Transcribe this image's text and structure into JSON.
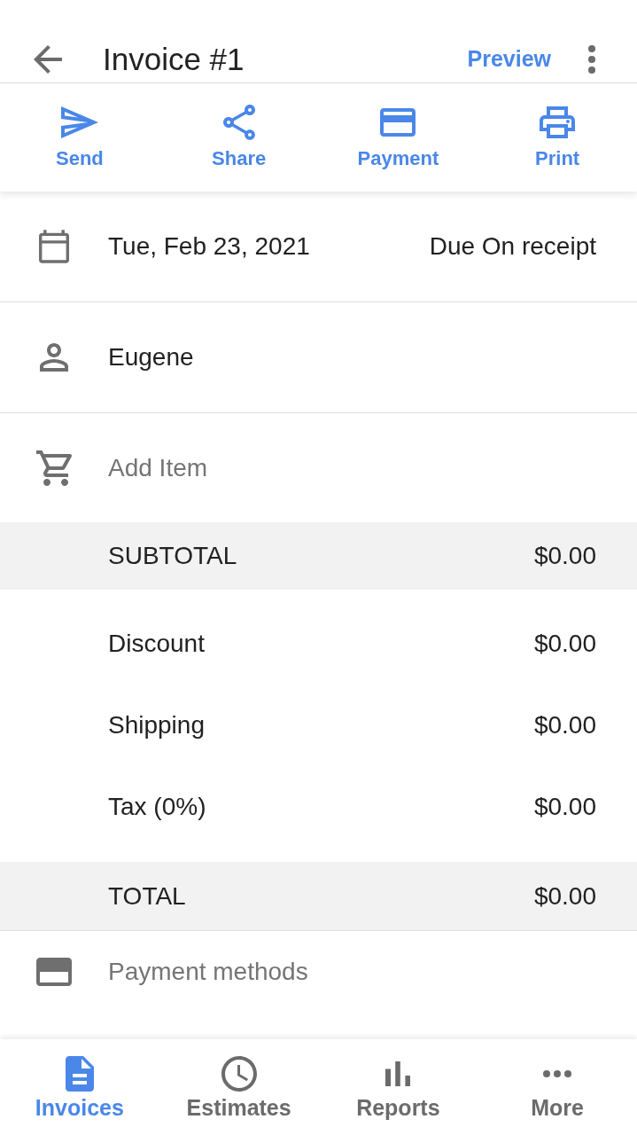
{
  "app_bar": {
    "title": "Invoice #1",
    "action": "Preview"
  },
  "actions": [
    {
      "kind": "send",
      "label": "Send"
    },
    {
      "kind": "share",
      "label": "Share"
    },
    {
      "kind": "payment",
      "label": "Payment"
    },
    {
      "kind": "print",
      "label": "Print"
    }
  ],
  "invoice": {
    "date": "Tue, Feb 23, 2021",
    "terms": "Due On receipt",
    "customer": "Eugene",
    "add_item": "Add Item"
  },
  "summary": [
    {
      "kind": "total",
      "label": "SUBTOTAL",
      "amount": "$0.00"
    },
    {
      "kind": "line",
      "label": "Discount",
      "amount": "$0.00"
    },
    {
      "kind": "line",
      "label": "Shipping",
      "amount": "$0.00"
    },
    {
      "kind": "line",
      "label": "Tax (0%)",
      "amount": "$0.00"
    },
    {
      "kind": "total",
      "label": "TOTAL",
      "amount": "$0.00"
    }
  ],
  "payment_methods": {
    "label": "Payment methods"
  },
  "bottom_nav": [
    {
      "kind": "invoices",
      "label": "Invoices",
      "selected": true
    },
    {
      "kind": "estimates",
      "label": "Estimates",
      "selected": false
    },
    {
      "kind": "reports",
      "label": "Reports",
      "selected": false
    },
    {
      "kind": "more",
      "label": "More",
      "selected": false
    }
  ]
}
